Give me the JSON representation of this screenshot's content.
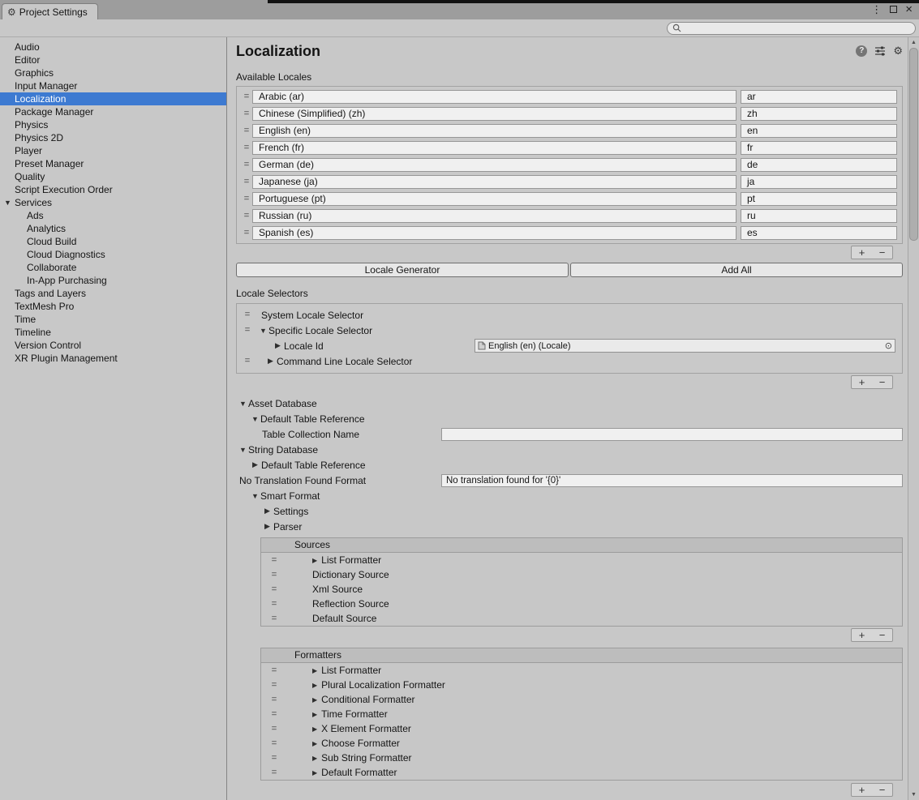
{
  "window": {
    "tab_title": "Project Settings",
    "controls": {
      "menu": "⋮",
      "close": "×"
    }
  },
  "search": {
    "value": ""
  },
  "sidebar": {
    "items": [
      {
        "label": "Audio"
      },
      {
        "label": "Editor"
      },
      {
        "label": "Graphics"
      },
      {
        "label": "Input Manager"
      },
      {
        "label": "Localization",
        "selected": true
      },
      {
        "label": "Package Manager"
      },
      {
        "label": "Physics"
      },
      {
        "label": "Physics 2D"
      },
      {
        "label": "Player"
      },
      {
        "label": "Preset Manager"
      },
      {
        "label": "Quality"
      },
      {
        "label": "Script Execution Order"
      },
      {
        "label": "Services",
        "expanded": true
      },
      {
        "label": "Ads",
        "child": true
      },
      {
        "label": "Analytics",
        "child": true
      },
      {
        "label": "Cloud Build",
        "child": true
      },
      {
        "label": "Cloud Diagnostics",
        "child": true
      },
      {
        "label": "Collaborate",
        "child": true
      },
      {
        "label": "In-App Purchasing",
        "child": true
      },
      {
        "label": "Tags and Layers"
      },
      {
        "label": "TextMesh Pro"
      },
      {
        "label": "Time"
      },
      {
        "label": "Timeline"
      },
      {
        "label": "Version Control"
      },
      {
        "label": "XR Plugin Management"
      }
    ]
  },
  "main": {
    "title": "Localization",
    "sections": {
      "available_locales": "Available Locales",
      "locale_selectors": "Locale Selectors"
    },
    "locales": [
      {
        "name": "Arabic (ar)",
        "code": "ar"
      },
      {
        "name": "Chinese (Simplified) (zh)",
        "code": "zh"
      },
      {
        "name": "English (en)",
        "code": "en"
      },
      {
        "name": "French (fr)",
        "code": "fr"
      },
      {
        "name": "German (de)",
        "code": "de"
      },
      {
        "name": "Japanese (ja)",
        "code": "ja"
      },
      {
        "name": "Portuguese (pt)",
        "code": "pt"
      },
      {
        "name": "Russian (ru)",
        "code": "ru"
      },
      {
        "name": "Spanish (es)",
        "code": "es"
      }
    ],
    "actions": {
      "locale_generator": "Locale Generator",
      "add_all": "Add All"
    },
    "selectors": {
      "system": "System Locale Selector",
      "specific": "Specific Locale Selector",
      "locale_id_label": "Locale Id",
      "locale_id_value": "English (en) (Locale)",
      "command_line": "Command Line Locale Selector"
    },
    "asset_database": {
      "label": "Asset Database",
      "default_table_reference": "Default Table Reference",
      "table_collection_name_label": "Table Collection Name",
      "table_collection_name_value": ""
    },
    "string_database": {
      "label": "String Database",
      "default_table_reference": "Default Table Reference",
      "no_translation_format_label": "No Translation Found Format",
      "no_translation_format_value": "No translation found for '{0}'",
      "smart_format": "Smart Format",
      "settings": "Settings",
      "parser": "Parser"
    },
    "sources": {
      "header": "Sources",
      "items": [
        {
          "label": "List Formatter",
          "expandable": true
        },
        {
          "label": "Dictionary Source"
        },
        {
          "label": "Xml Source"
        },
        {
          "label": "Reflection Source"
        },
        {
          "label": "Default Source"
        }
      ]
    },
    "formatters": {
      "header": "Formatters",
      "items": [
        {
          "label": "List Formatter",
          "expandable": true
        },
        {
          "label": "Plural Localization Formatter",
          "expandable": true
        },
        {
          "label": "Conditional Formatter",
          "expandable": true
        },
        {
          "label": "Time Formatter",
          "expandable": true
        },
        {
          "label": "X Element Formatter",
          "expandable": true
        },
        {
          "label": "Choose Formatter",
          "expandable": true
        },
        {
          "label": "Sub String Formatter",
          "expandable": true
        },
        {
          "label": "Default Formatter",
          "expandable": true
        }
      ]
    },
    "list_controls": {
      "add": "+",
      "remove": "−"
    }
  }
}
